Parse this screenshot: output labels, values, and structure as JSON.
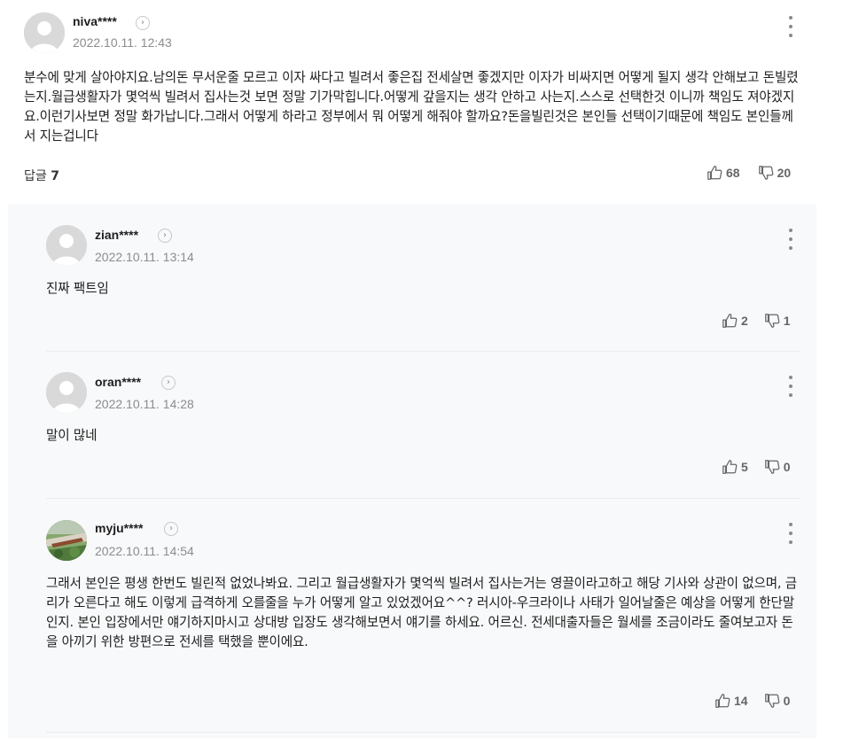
{
  "parent": {
    "nickname": "niva****",
    "date": "2022.10.11. 12:43",
    "text": "분수에 맞게 살아야지요.남의돈 무서운줄 모르고 이자 싸다고 빌려서 좋은집 전세살면 좋겠지만 이자가 비싸지면 어떻게 될지 생각 안해보고 돈빌렸는지.월급생활자가 몇억씩 빌려서 집사는것 보면 정말 기가막힙니다.어떻게 갚을지는 생각 안하고 사는지.스스로 선택한것 이니까 책임도 져야겠지요.이런기사보면 정말 화가납니다.그래서 어떻게 하라고 정부에서 뭐 어떻게 해줘야 할까요?돈을빌린것은 본인들 선택이기때문에 책임도 본인들께서 지는겁니다",
    "reply_label": "답글",
    "reply_count": "7",
    "likes": "68",
    "dislikes": "20"
  },
  "replies": [
    {
      "nickname": "zian****",
      "date": "2022.10.11. 13:14",
      "text": "진짜 팩트임",
      "likes": "2",
      "dislikes": "1"
    },
    {
      "nickname": "oran****",
      "date": "2022.10.11. 14:28",
      "text": "말이 많네",
      "likes": "5",
      "dislikes": "0"
    },
    {
      "nickname": "myju****",
      "date": "2022.10.11. 14:54",
      "text": "그래서 본인은 평생 한번도 빌린적 없었나봐요. 그리고 월급생활자가 몇억씩 빌려서 집사는거는 영끌이라고하고 해당 기사와 상관이 없으며, 금리가 오른다고 해도 이렇게 급격하게 오를줄을 누가 어떻게 알고 있었겠어요^^? 러시아-우크라이나 사태가 일어날줄은 예상을 어떻게 한단말인지. 본인 입장에서만 얘기하지마시고 상대방 입장도 생각해보면서 얘기를 하세요. 어르신. 전세대출자들은 월세를 조금이라도 줄여보고자 돈을 아끼기 위한 방편으로 전세를 택했을 뿐이에요.",
      "likes": "14",
      "dislikes": "0"
    }
  ],
  "icons": {
    "more": "more-vertical-icon",
    "profile_arrow": "chevron-right-icon",
    "like": "thumbs-up-icon",
    "dislike": "thumbs-down-icon"
  }
}
